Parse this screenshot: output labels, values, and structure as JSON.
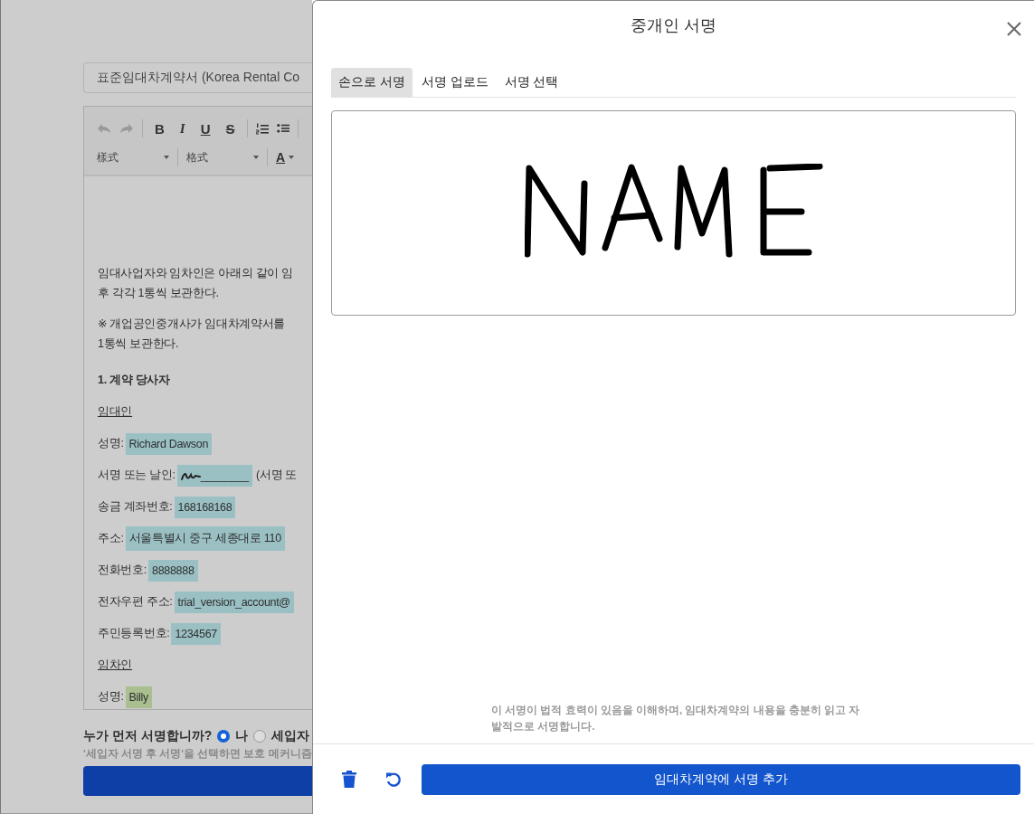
{
  "document": {
    "title_field": "표준임대차계약서 (Korea Rental Co",
    "toolbar": {
      "row_1": [
        {
          "kind": "undo"
        },
        {
          "kind": "redo"
        },
        {
          "kind": "separator"
        },
        {
          "kind": "bold",
          "label": "B"
        },
        {
          "kind": "italic",
          "label": "I"
        },
        {
          "kind": "underline",
          "label": "U"
        },
        {
          "kind": "strike",
          "label": "S"
        },
        {
          "kind": "separator"
        },
        {
          "kind": "ordered-list"
        },
        {
          "kind": "bullet-list"
        },
        {
          "kind": "separator"
        }
      ],
      "row_2": [
        {
          "kind": "dropdown",
          "label": "樣式"
        },
        {
          "kind": "separator"
        },
        {
          "kind": "dropdown",
          "label": "格式"
        },
        {
          "kind": "separator"
        },
        {
          "kind": "text-color",
          "label": "A"
        }
      ]
    },
    "body": [
      {
        "kind": "paragraph",
        "lines": [
          "임대사업자와 임차인은 아래의 같이 임",
          "후 각각 1통씩 보관한다."
        ]
      },
      {
        "kind": "paragraph",
        "lines": [
          "※ 개업공인중개사가 임대차계약서를",
          "1통씩 보관한다."
        ]
      },
      {
        "kind": "heading",
        "text": "1. 계약 당사자"
      },
      {
        "kind": "party",
        "text": "임대인"
      },
      {
        "kind": "field",
        "label": "성명:",
        "value": "Richard Dawson",
        "color": "#9ac0c4"
      },
      {
        "kind": "field",
        "label": "서명 또는 날인:",
        "value": "________",
        "color": "#9ac0c4",
        "signature": true,
        "trailing": "(서명 또"
      },
      {
        "kind": "field",
        "label": "송금 계좌번호:",
        "value": "168168168",
        "color": "#9ac0c4"
      },
      {
        "kind": "field",
        "label": "주소:",
        "value": "서울특별시 중구 세종대로 110",
        "color": "#9ac0c4"
      },
      {
        "kind": "field",
        "label": "전화번호:",
        "value": "8888888",
        "color": "#9ac0c4"
      },
      {
        "kind": "field",
        "label": "전자우편 주소:",
        "value": "trial_version_account@",
        "color": "#9ac0c4"
      },
      {
        "kind": "field",
        "label": "주민등록번호:",
        "value": "1234567",
        "color": "#9ac0c4"
      },
      {
        "kind": "party",
        "text": "임차인"
      },
      {
        "kind": "field",
        "label": "성명:",
        "value": "Billy",
        "color": "#a9bf8f"
      }
    ],
    "first_signer": {
      "question": "누가 먼저 서명합니까?",
      "options": [
        {
          "label": "나",
          "selected": true
        },
        {
          "label": "세입자",
          "selected": false
        }
      ]
    },
    "hint": "'세입자 서명 후 서명'을 선택하면 보호 메커니즘"
  },
  "modal": {
    "title": "중개인 서명",
    "tabs": [
      {
        "label": "손으로 서명",
        "selected": true
      },
      {
        "label": "서명 업로드",
        "selected": false
      },
      {
        "label": "서명 선택",
        "selected": false
      }
    ],
    "notice": "이 서명이 법적 효력이 있음을 이해하며, 임대차계약의 내용을 충분히 읽고 자발적으로 서명합니다.",
    "submit": "임대차계약에 서명 추가"
  }
}
